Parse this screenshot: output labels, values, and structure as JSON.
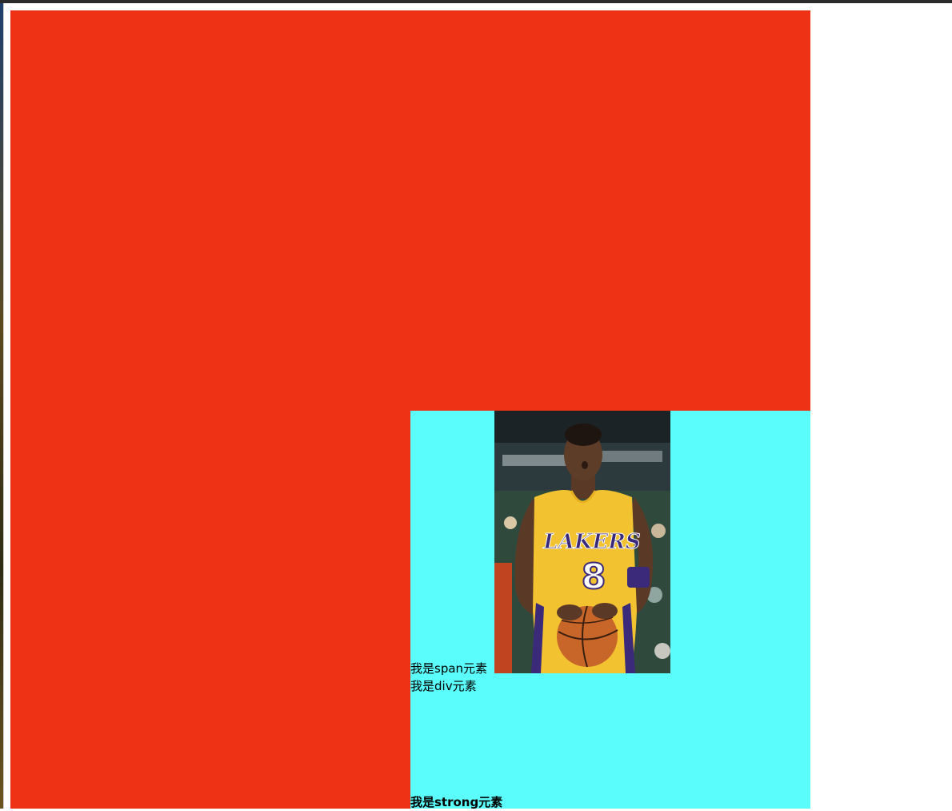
{
  "elements": {
    "span_text": "我是span元素",
    "div_text": "我是div元素",
    "strong_text": "我是strong元素"
  },
  "photo": {
    "jersey_team": "LAKERS",
    "jersey_number": "8"
  },
  "colors": {
    "outer_box": "#ee3216",
    "inner_box": "#5bfdfc",
    "jersey": "#f2c230",
    "jersey_trim": "#3b2a7a"
  }
}
